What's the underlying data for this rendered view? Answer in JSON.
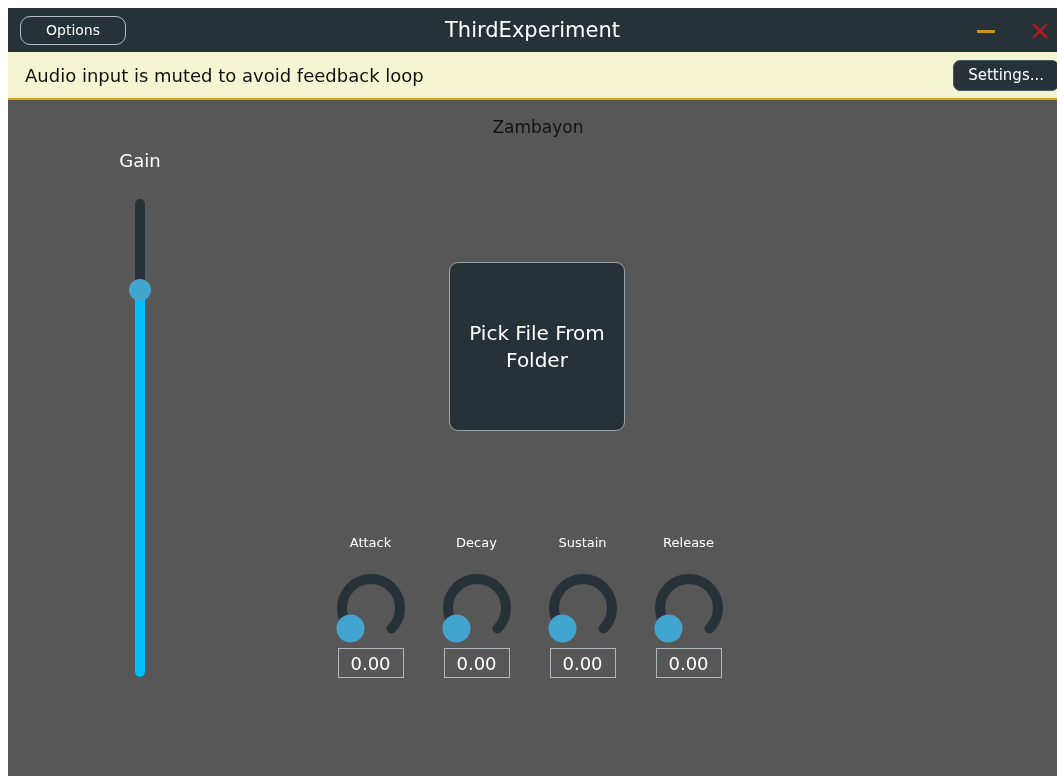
{
  "window": {
    "title": "ThirdExperiment",
    "options_button": "Options"
  },
  "banner": {
    "message": "Audio input is muted to avoid feedback loop",
    "button": "Settings..."
  },
  "plugin": {
    "title": "Zambayon",
    "gain": {
      "label": "Gain",
      "level": 0.81
    },
    "pick_button": "Pick File From Folder",
    "knobs": [
      {
        "label": "Attack",
        "level": 0,
        "value": "0.00"
      },
      {
        "label": "Decay",
        "level": 0,
        "value": "0.00"
      },
      {
        "label": "Sustain",
        "level": 0,
        "value": "0.00"
      },
      {
        "label": "Release",
        "level": 0,
        "value": "0.00"
      }
    ]
  }
}
